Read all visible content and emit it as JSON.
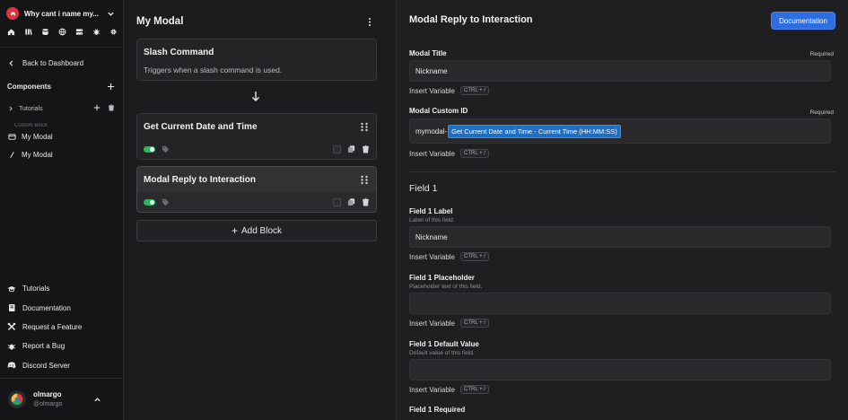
{
  "sidebar": {
    "server_name": "Why cant i name my...",
    "back_label": "Back to Dashboard",
    "components_label": "Components",
    "tutorials_folder": "Tutorials",
    "ghost_item": "Custom Block",
    "modal_items": [
      "My Modal",
      "My Modal"
    ],
    "bottom_nav": [
      "Tutorials",
      "Documentation",
      "Request a Feature",
      "Report a Bug",
      "Discord Server"
    ],
    "user": {
      "name": "olmargo",
      "handle": "@olmargo"
    }
  },
  "middle": {
    "title": "My Modal",
    "trigger": {
      "title": "Slash Command",
      "subtitle": "Triggers when a slash command is used."
    },
    "blocks": [
      {
        "title": "Get Current Date and Time"
      },
      {
        "title": "Modal Reply to Interaction"
      }
    ],
    "add_block_label": "Add Block"
  },
  "right": {
    "title": "Modal Reply to Interaction",
    "doc_button": "Documentation",
    "required_label": "Required",
    "insert_variable": "Insert Variable",
    "shortcut": "CTRL + /",
    "modal_title": {
      "label": "Modal Title",
      "value": "Nickname"
    },
    "modal_custom_id": {
      "label": "Modal Custom ID",
      "prefix": "mymodal-",
      "variable": "Get Current Date and Time - Current Time (HH:MM:SS)"
    },
    "section_title": "Field 1",
    "field_label": {
      "label": "Field 1 Label",
      "help": "Label of this field.",
      "value": "Nickname"
    },
    "field_placeholder": {
      "label": "Field 1 Placeholder",
      "help": "Placeholder text of this field.",
      "value": ""
    },
    "field_default": {
      "label": "Field 1 Default Value",
      "help": "Default value of this field.",
      "value": ""
    },
    "field_required": {
      "label": "Field 1 Required"
    }
  },
  "colors": {
    "accent_blue": "#2f6ee0",
    "toggle_green": "#2bb560",
    "server_logo": "#e0333b",
    "variable_pill": "#1e6fc3"
  }
}
